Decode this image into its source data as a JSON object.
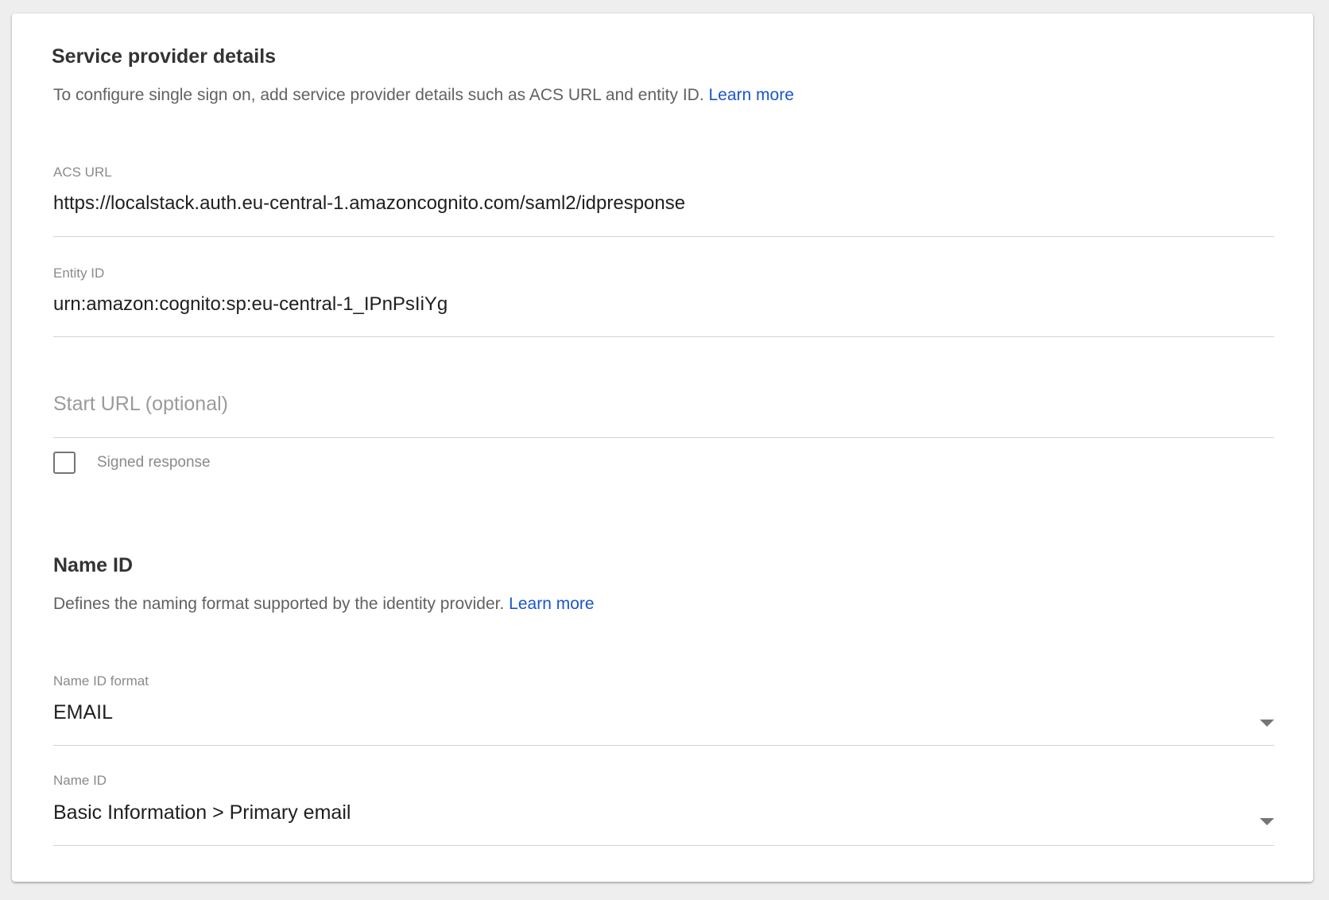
{
  "service_provider": {
    "title": "Service provider details",
    "description": "To configure single sign on, add service provider details such as ACS URL and entity ID.",
    "learn_more": "Learn more",
    "acs_url": {
      "label": "ACS URL",
      "value": "https://localstack.auth.eu-central-1.amazoncognito.com/saml2/idpresponse"
    },
    "entity_id": {
      "label": "Entity ID",
      "value": "urn:amazon:cognito:sp:eu-central-1_IPnPsIiYg"
    },
    "start_url": {
      "placeholder": "Start URL (optional)",
      "value": ""
    },
    "signed_response": {
      "label": "Signed response",
      "checked": false
    }
  },
  "name_id_section": {
    "title": "Name ID",
    "description": "Defines the naming format supported by the identity provider.",
    "learn_more": "Learn more",
    "name_id_format": {
      "label": "Name ID format",
      "selected": "EMAIL"
    },
    "name_id": {
      "label": "Name ID",
      "selected": "Basic Information > Primary email"
    }
  },
  "colors": {
    "link": "#1a56c8",
    "background": "#eeeeee",
    "card": "#ffffff"
  },
  "icons": {
    "dropdown": "chevron-down-icon",
    "checkbox": "checkbox-unchecked-icon"
  }
}
